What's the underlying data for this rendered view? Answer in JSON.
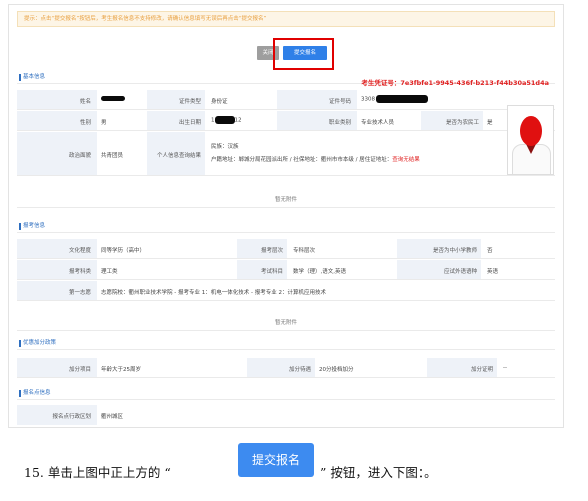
{
  "notice": "提示：点击“提交报名”按钮后，考生报名信息不支持修改，请确认信息填写无误后再点击“提交报名”",
  "buttons": {
    "back": "关闭",
    "submit": "提交报名"
  },
  "basic": {
    "heading": "基本信息",
    "cert_label": "考生凭证号：",
    "cert_value": "7e3fbfe1-9945-436f-b213-f44b30a51d4a",
    "name_label": "姓名",
    "id_type_label": "证件类型",
    "id_type": "身份证",
    "id_no_label": "证件号码",
    "id_no_prefix": "3308",
    "gender_label": "性别",
    "gender": "男",
    "birth_label": "出生日期",
    "birth_prefix": "1",
    "birth_suffix": "12",
    "job_label": "职业类别",
    "job": "专业技术人员",
    "farmer_label": "是否为农民工",
    "farmer": "是",
    "politics_label": "政治面貌",
    "politics": "共青团员",
    "check_label": "个人信息查询结果",
    "ethnic": "民族：汉族",
    "hukou_text": "户籍地址：郸城分局花园派出所 / 社保地址：衢州市市本级 / 居住证地址：",
    "hukou_result": "查询无结果",
    "no_attachment": "暂无附件"
  },
  "exam": {
    "heading": "报考信息",
    "edu_label": "文化程度",
    "edu": "同等学历（高中）",
    "level_label": "报考层次",
    "level": "专科层次",
    "teacher_label": "是否为中小学教师",
    "teacher": "否",
    "subject_label": "报考科类",
    "subject": "理工类",
    "exam_subjects_label": "考试科目",
    "exam_subjects": "数学（理）,语文,英语",
    "lang_label": "应试外语语种",
    "lang": "英语",
    "choice_label": "第一志愿",
    "choice": "志愿院校：衢州职业技术学院 - 报考专业 1：机电一体化技术 - 报考专业 2：计算机应用技术",
    "no_attachment": "暂无附件"
  },
  "bonus": {
    "heading": "优惠加分政策",
    "item_label": "加分项目",
    "item": "年龄大于25周岁",
    "treat_label": "加分待遇",
    "treat": "20分投档加分",
    "proof_label": "加分证明",
    "proof": "--"
  },
  "site": {
    "heading": "报名点信息",
    "area_label": "报名点行政区划",
    "area": "衢州城区"
  },
  "instruction": {
    "prefix": "15. 单击上图中正上方的 “",
    "button": "提交报名",
    "suffix": "” 按钮，进入下图：。"
  },
  "colors": {
    "accent": "#2f80e8",
    "highlight": "#e00000",
    "cert": "#e02020"
  }
}
